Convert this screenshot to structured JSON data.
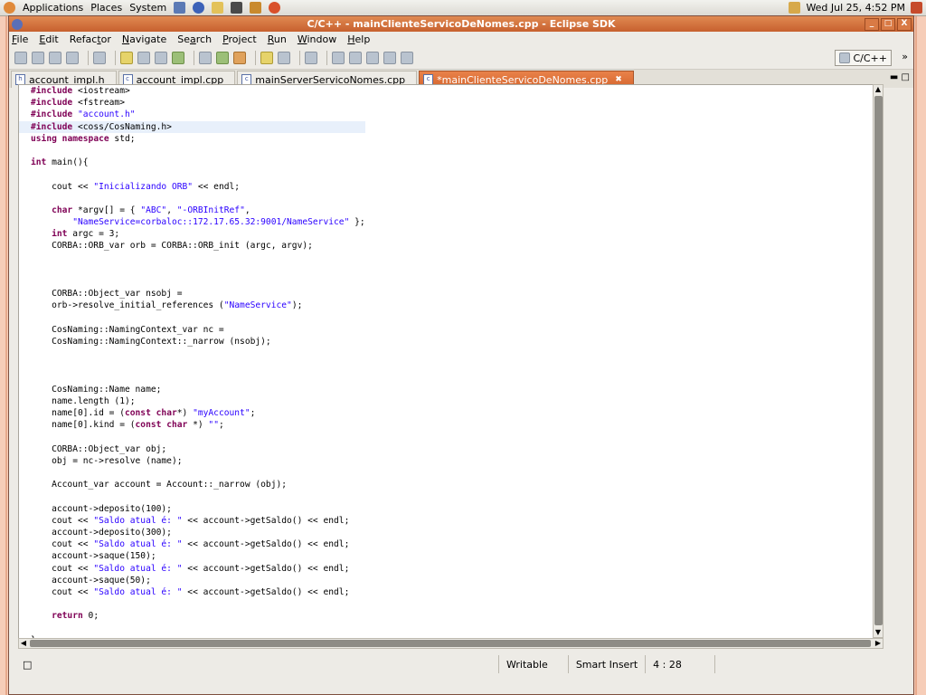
{
  "panel": {
    "menus": [
      "Applications",
      "Places",
      "System"
    ],
    "clock": "Wed Jul 25,  4:52 PM"
  },
  "window": {
    "title": "C/C++ - mainClienteServicoDeNomes.cpp - Eclipse SDK",
    "buttons": [
      "_",
      "□",
      "X"
    ]
  },
  "menubar": {
    "items": [
      "File",
      "Edit",
      "Refactor",
      "Navigate",
      "Search",
      "Project",
      "Run",
      "Window",
      "Help"
    ],
    "mnemonic_index": [
      0,
      0,
      5,
      0,
      2,
      0,
      0,
      0,
      0
    ]
  },
  "toolbar": {
    "perspective": "C/C++",
    "overflow": "»"
  },
  "tabs": [
    {
      "label": "account_impl.h",
      "icon": "h",
      "active": false
    },
    {
      "label": "account_impl.cpp",
      "icon": "c",
      "active": false
    },
    {
      "label": "mainServerServicoNomes.cpp",
      "icon": "c",
      "active": false
    },
    {
      "label": "*mainClienteServicoDeNomes.cpp",
      "icon": "c",
      "active": true
    }
  ],
  "editor": {
    "current_line": 3,
    "lines": [
      "#include <iostream>",
      "#include <fstream>",
      "#include \"account.h\"",
      "#include <coss/CosNaming.h>",
      "using namespace std;",
      "",
      "int main(){",
      "",
      "    cout << \"Inicializando ORB\" << endl;",
      "",
      "    char *argv[] = { \"ABC\", \"-ORBInitRef\",",
      "        \"NameService=corbaloc::172.17.65.32:9001/NameService\" };",
      "    int argc = 3;",
      "    CORBA::ORB_var orb = CORBA::ORB_init (argc, argv);",
      "",
      "",
      "",
      "    CORBA::Object_var nsobj =",
      "    orb->resolve_initial_references (\"NameService\");",
      "",
      "    CosNaming::NamingContext_var nc =",
      "    CosNaming::NamingContext::_narrow (nsobj);",
      "",
      "",
      "",
      "    CosNaming::Name name;",
      "    name.length (1);",
      "    name[0].id = (const char*) \"myAccount\";",
      "    name[0].kind = (const char *) \"\";",
      "",
      "    CORBA::Object_var obj;",
      "    obj = nc->resolve (name);",
      "",
      "    Account_var account = Account::_narrow (obj);",
      "",
      "    account->deposito(100);",
      "    cout << \"Saldo atual é: \" << account->getSaldo() << endl;",
      "    account->deposito(300);",
      "    cout << \"Saldo atual é: \" << account->getSaldo() << endl;",
      "    account->saque(150);",
      "    cout << \"Saldo atual é: \" << account->getSaldo() << endl;",
      "    account->saque(50);",
      "    cout << \"Saldo atual é: \" << account->getSaldo() << endl;",
      "",
      "    return 0;",
      "",
      "}"
    ]
  },
  "status": {
    "mode": "Writable",
    "insert": "Smart Insert",
    "position": "4 : 28"
  },
  "colors": {
    "title_accent": "#d5652d",
    "keyword": "#7f0055",
    "string": "#2a00ff"
  }
}
